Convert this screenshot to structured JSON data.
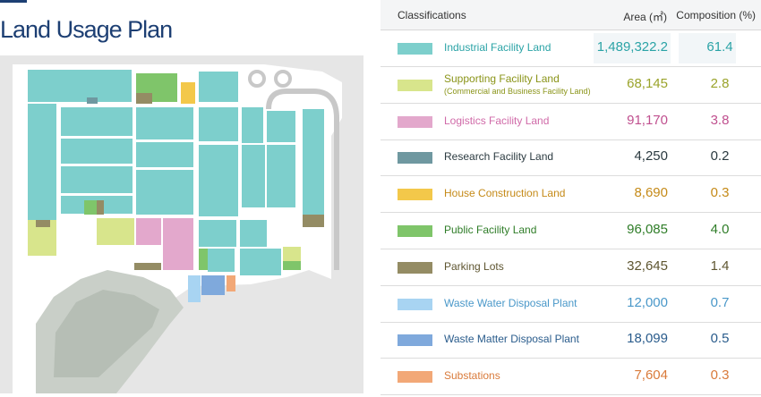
{
  "title": "Land Usage Plan",
  "table": {
    "header": {
      "classifications": "Classifications",
      "area": "Area (㎡)",
      "composition": "Composition (%)"
    },
    "rows": [
      {
        "name": "Industrial Facility Land",
        "sub": "",
        "area": "1,489,322.2",
        "composition": "61.4",
        "swatch": "#7dcfcc",
        "text_color": "#2aa3a6",
        "value_color": "#2aa3a6"
      },
      {
        "name": "Supporting Facility Land",
        "sub": "(Commercial and Business Facility Land)",
        "area": "68,145",
        "composition": "2.8",
        "swatch": "#d8e58c",
        "text_color": "#8a9418",
        "value_color": "#9aa32a"
      },
      {
        "name": "Logistics Facility Land",
        "sub": "",
        "area": "91,170",
        "composition": "3.8",
        "swatch": "#e3a8cc",
        "text_color": "#d06aa8",
        "value_color": "#c0508f"
      },
      {
        "name": "Research Facility Land",
        "sub": "",
        "area": "4,250",
        "composition": "0.2",
        "swatch": "#6f98a0",
        "text_color": "#2b3a40",
        "value_color": "#2b3a40"
      },
      {
        "name": "House Construction Land",
        "sub": "",
        "area": "8,690",
        "composition": "0.3",
        "swatch": "#f3c84a",
        "text_color": "#c58a18",
        "value_color": "#c58a18"
      },
      {
        "name": "Public Facility Land",
        "sub": "",
        "area": "96,085",
        "composition": "4.0",
        "swatch": "#7fc56a",
        "text_color": "#2f7d28",
        "value_color": "#2f7d28"
      },
      {
        "name": "Parking Lots",
        "sub": "",
        "area": "32,645",
        "composition": "1.4",
        "swatch": "#948c64",
        "text_color": "#5e5530",
        "value_color": "#5e5530"
      },
      {
        "name": "Waste Water Disposal Plant",
        "sub": "",
        "area": "12,000",
        "composition": "0.7",
        "swatch": "#a8d4f2",
        "text_color": "#4a98c9",
        "value_color": "#4a98c9"
      },
      {
        "name": "Waste Matter Disposal Plant",
        "sub": "",
        "area": "18,099",
        "composition": "0.5",
        "swatch": "#7fa9dc",
        "text_color": "#2a5c8c",
        "value_color": "#2a5c8c"
      },
      {
        "name": "Substations",
        "sub": "",
        "area": "7,604",
        "composition": "0.3",
        "swatch": "#f2a877",
        "text_color": "#d97a3a",
        "value_color": "#d97a3a"
      }
    ]
  }
}
